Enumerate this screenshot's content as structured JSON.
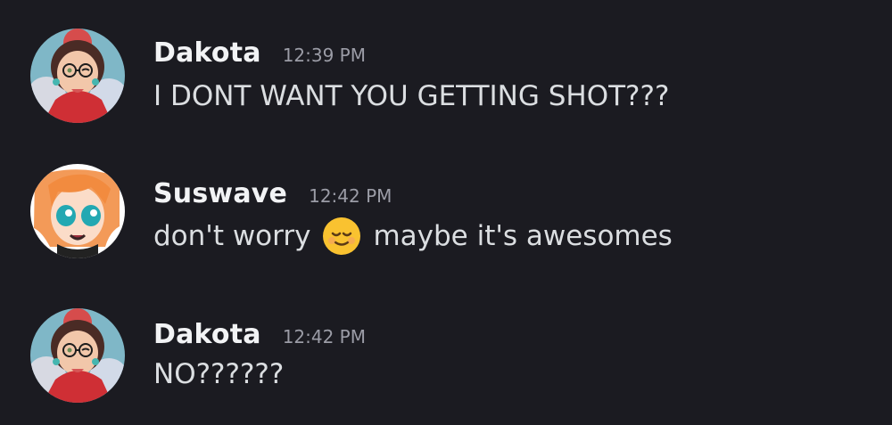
{
  "messages": [
    {
      "author": "Dakota",
      "timestamp": "12:39 PM",
      "text": "I DONT WANT YOU GETTING SHOT???",
      "avatar_icon": "dakota-avatar"
    },
    {
      "author": "Suswave",
      "timestamp": "12:42 PM",
      "text_before_emoji": "don't worry",
      "emoji_icon": "relieved-face-emoji",
      "text_after_emoji": "maybe it's awesomes",
      "avatar_icon": "suswave-avatar"
    },
    {
      "author": "Dakota",
      "timestamp": "12:42 PM",
      "text": "NO??????",
      "avatar_icon": "dakota-avatar"
    }
  ],
  "colors": {
    "background": "#1b1b21",
    "username": "#f2f3f5",
    "timestamp": "#9b9ca6",
    "message_text": "#dbdee1"
  }
}
